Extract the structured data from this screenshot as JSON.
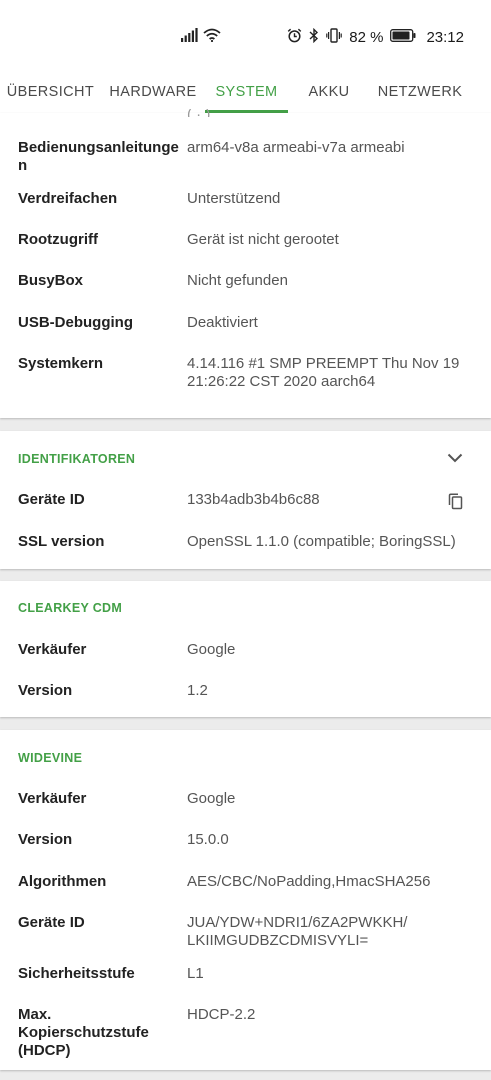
{
  "status_bar": {
    "battery_percent": "82 %",
    "time": "23:12",
    "icons": [
      "signal-icon",
      "wifi-icon",
      "alarm-icon",
      "bluetooth-icon",
      "vibrate-icon",
      "battery-icon"
    ]
  },
  "tabs": [
    {
      "label": "ÜBERSICHT",
      "active": false
    },
    {
      "label": "HARDWARE",
      "active": false
    },
    {
      "label": "SYSTEM",
      "active": true
    },
    {
      "label": "AKKU",
      "active": false
    },
    {
      "label": "NETZWERK",
      "active": false
    }
  ],
  "system": {
    "cut_off_text": "( · )",
    "rows": [
      {
        "label": "Bedienungsanleitunge n",
        "value": "arm64-v8a armeabi-v7a armeabi"
      },
      {
        "label": "Verdreifachen",
        "value": "Unterstützend"
      },
      {
        "label": "Rootzugriff",
        "value": "Gerät ist nicht gerootet"
      },
      {
        "label": "BusyBox",
        "value": "Nicht gefunden"
      },
      {
        "label": "USB-Debugging",
        "value": "Deaktiviert"
      },
      {
        "label": "Systemkern",
        "value": "4.14.116 #1 SMP PREEMPT Thu Nov 19 21:26:22 CST 2020 aarch64"
      }
    ]
  },
  "identifiers": {
    "title": "IDENTIFIKATOREN",
    "rows": [
      {
        "label": "Geräte ID",
        "value": "133b4adb3b4b6c88"
      },
      {
        "label": "SSL version",
        "value": "OpenSSL 1.1.0 (compatible; BoringSSL)"
      }
    ]
  },
  "clearkey": {
    "title": "CLEARKEY CDM",
    "rows": [
      {
        "label": "Verkäufer",
        "value": "Google"
      },
      {
        "label": "Version",
        "value": "1.2"
      }
    ]
  },
  "widevine": {
    "title": "WIDEVINE",
    "rows": [
      {
        "label": "Verkäufer",
        "value": "Google"
      },
      {
        "label": "Version",
        "value": "15.0.0"
      },
      {
        "label": "Algorithmen",
        "value": "AES/CBC/NoPadding,HmacSHA256"
      },
      {
        "label": "Geräte ID",
        "value": "JUA/YDW+NDRI1/6ZA2PWKKH/ LKIIMGUDBZCDMISVYLI="
      },
      {
        "label": "Sicherheitsstufe",
        "value": "L1"
      },
      {
        "label": "Max. Kopierschutzstufe (HDCP)",
        "value": "HDCP-2.2"
      }
    ]
  },
  "colors": {
    "accent": "#43a047",
    "background": "#ececec",
    "card": "#ffffff"
  }
}
